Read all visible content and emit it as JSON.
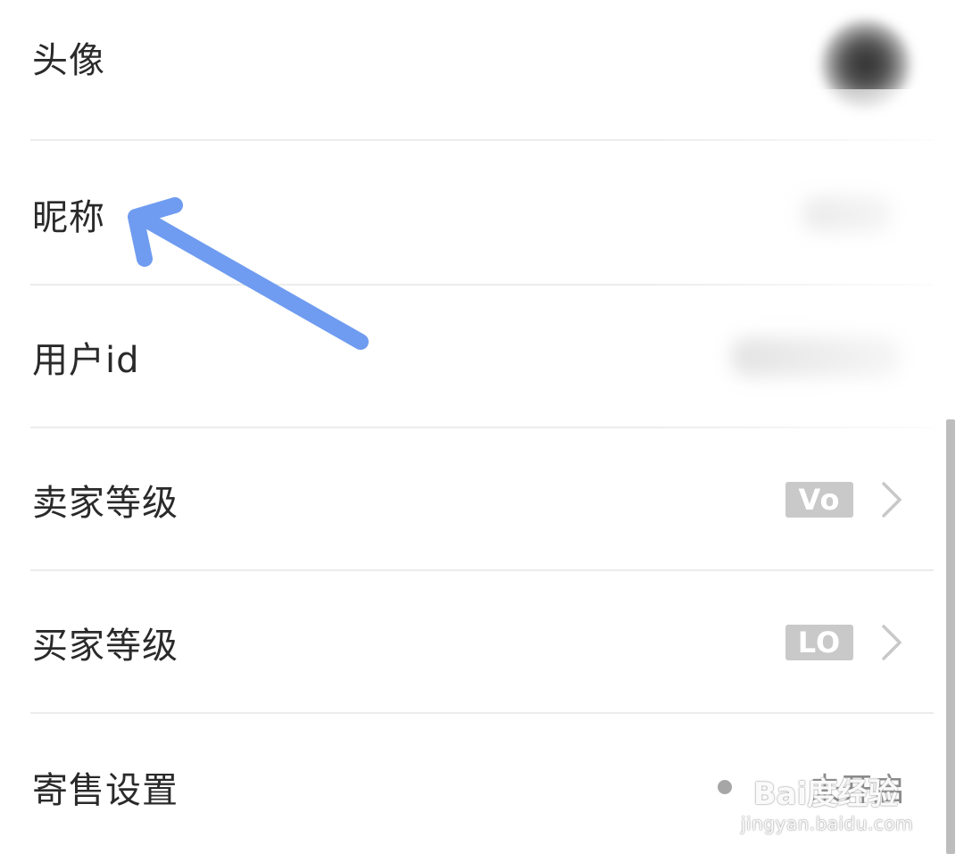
{
  "settings": {
    "rows": [
      {
        "label": "头像"
      },
      {
        "label": "昵称"
      },
      {
        "label": "用户id"
      },
      {
        "label": "卖家等级",
        "badge": "Vo"
      },
      {
        "label": "买家等级",
        "badge": "LO"
      },
      {
        "label": "寄售设置",
        "value": "未开启"
      }
    ]
  },
  "annotation": {
    "arrow_color": "#6f9cf0",
    "target": "昵称"
  },
  "watermark": {
    "logo": "Bai度经验",
    "url": "jingyan.baidu.com"
  },
  "colors": {
    "label": "#2a2a2a",
    "divider": "#ececec",
    "badge_bg": "#c9c9c9",
    "chevron": "#c8c8c8"
  }
}
